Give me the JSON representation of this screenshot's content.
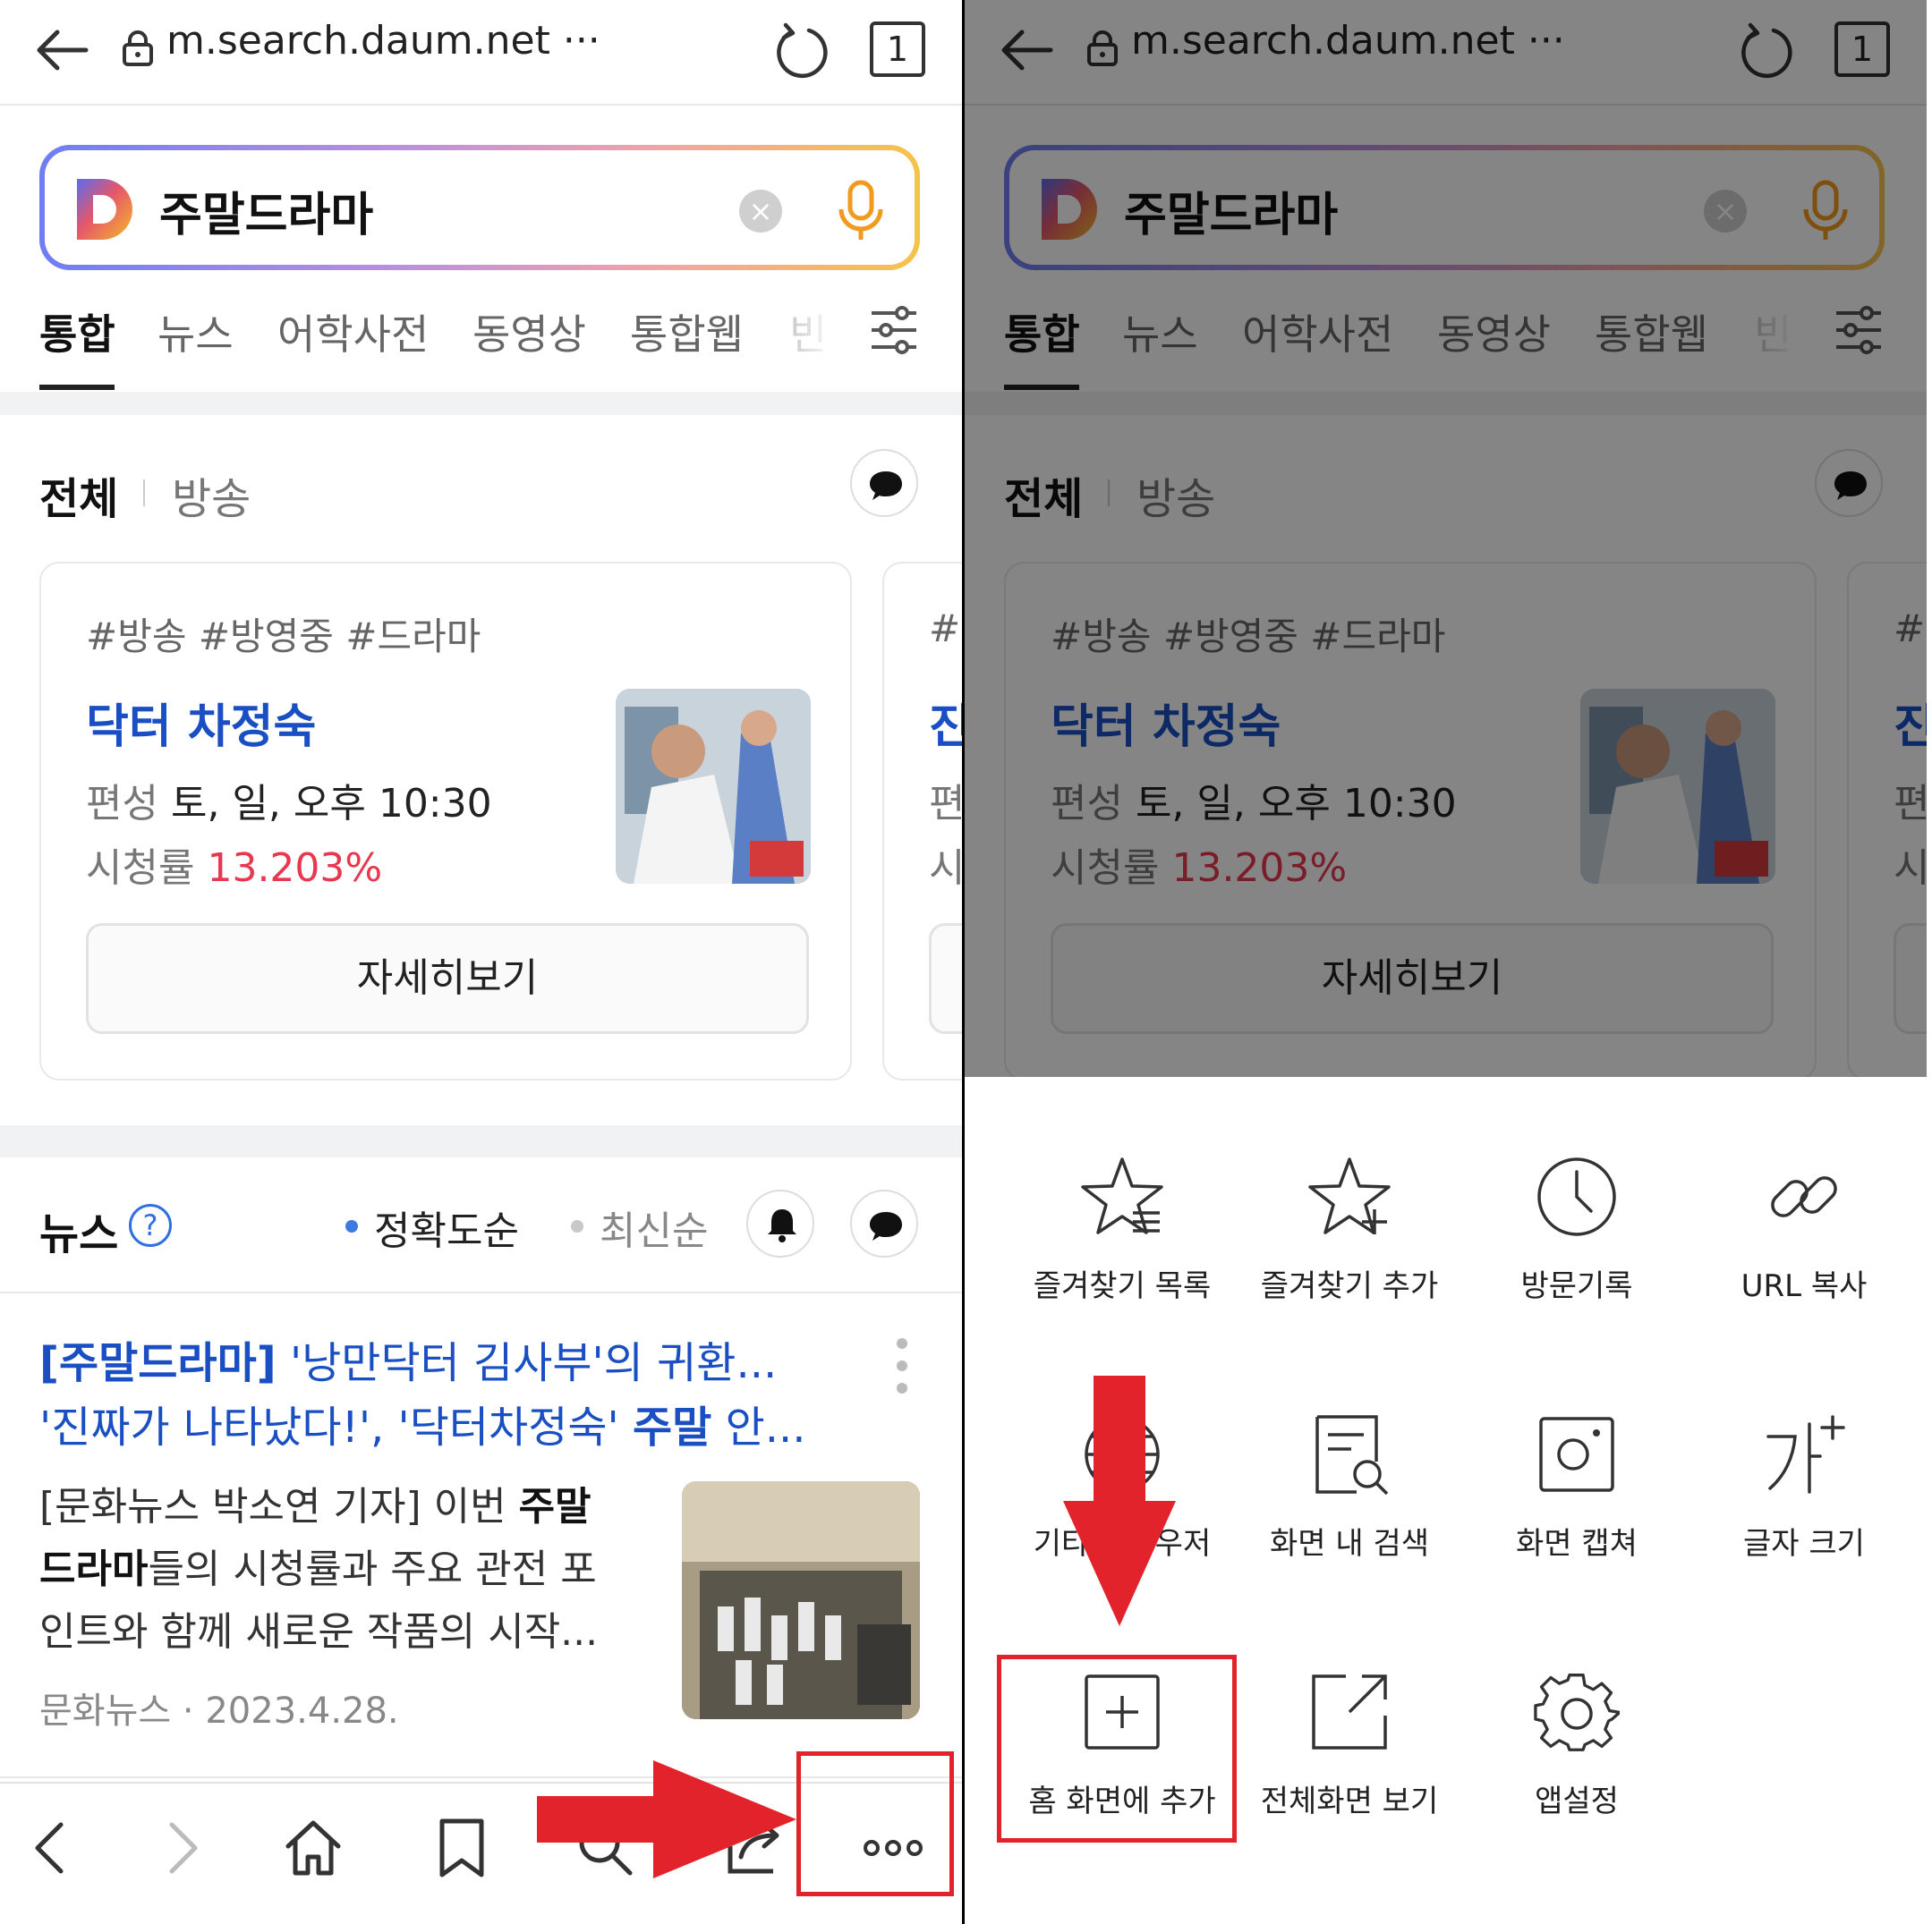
{
  "browser": {
    "url": "m.search.daum.net",
    "url_more": "···",
    "tab_count": "1"
  },
  "search": {
    "logo_letter": "D",
    "query": "주말드라마",
    "clear_glyph": "×"
  },
  "tabs": [
    "통합",
    "뉴스",
    "어학사전",
    "동영상",
    "통합웹",
    "빈"
  ],
  "broadcast_section": {
    "title": "전체",
    "subtitle": "방송"
  },
  "card": {
    "hashtags": "#방송 #방영중 #드라마",
    "title": "닥터 차정숙",
    "airtime_label": "편성",
    "airtime_value": "토, 일, 오후 10:30",
    "rating_label": "시청률",
    "rating_value": "13.203%",
    "detail_button": "자세히보기"
  },
  "card_peek": {
    "hashtag_start": "#",
    "title_start": "진",
    "line1_start": "편",
    "line2_start": "시"
  },
  "news_section": {
    "title": "뉴스",
    "help_glyph": "?",
    "sort_accurate": "정확도순",
    "sort_latest": "최신순"
  },
  "article": {
    "title_bracket": "[주말드라마]",
    "title_part1": " '낭만닥터 김사부'의 귀환...",
    "title_part2": "'진짜가 나타났다!', '닥터차정숙' ",
    "title_bold": "주말",
    "title_part3": " 안...",
    "body_part1": "[문화뉴스 박소연 기자] 이번 ",
    "body_bold1": "주말",
    "body_bold2": "드라마",
    "body_part2": "들의 시청률과 주요 관전 포인트와 함께 새로운 작품의 시작...",
    "source": "문화뉴스",
    "dot": "·",
    "date": "2023.4.28."
  },
  "menu": {
    "items": [
      {
        "label": "즐겨찾기 목록",
        "icon": "star-list-icon"
      },
      {
        "label": "즐겨찾기 추가",
        "icon": "star-add-icon"
      },
      {
        "label": "방문기록",
        "icon": "clock-icon"
      },
      {
        "label": "URL 복사",
        "icon": "link-icon"
      },
      {
        "label": "기타 브라우저",
        "icon": "globe-icon"
      },
      {
        "label": "화면 내 검색",
        "icon": "page-search-icon"
      },
      {
        "label": "화면 캡쳐",
        "icon": "camera-icon"
      },
      {
        "label": "글자 크기",
        "icon": "font-size-icon"
      },
      {
        "label": "홈 화면에 추가",
        "icon": "add-home-icon"
      },
      {
        "label": "전체화면 보기",
        "icon": "fullscreen-icon"
      },
      {
        "label": "앱설정",
        "icon": "gear-icon"
      }
    ]
  },
  "colors": {
    "annotation_red": "#e2232b",
    "link_blue": "#1a4fc4",
    "rating_red": "#e8384f"
  }
}
